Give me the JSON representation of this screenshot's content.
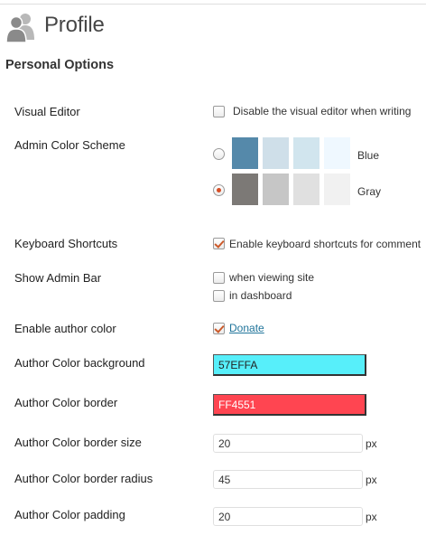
{
  "page": {
    "title": "Profile",
    "icon": "users-icon"
  },
  "section": {
    "title": "Personal Options"
  },
  "visual_editor": {
    "label": "Visual Editor",
    "checkbox_label": "Disable the visual editor when writing",
    "checked": false
  },
  "color_scheme": {
    "label": "Admin Color Scheme",
    "options": [
      {
        "name": "Blue",
        "selected": false,
        "colors": [
          "#5589aa",
          "#cfdfe9",
          "#d1e5ee",
          "#eff8ff"
        ]
      },
      {
        "name": "Gray",
        "selected": true,
        "colors": [
          "#7c7976",
          "#c6c6c6",
          "#e0e0e0",
          "#f1f1f1"
        ]
      }
    ]
  },
  "keyboard_shortcuts": {
    "label": "Keyboard Shortcuts",
    "checkbox_label": "Enable keyboard shortcuts for comment",
    "checked": true
  },
  "admin_bar": {
    "label": "Show Admin Bar",
    "options": [
      {
        "label": "when viewing site",
        "checked": false
      },
      {
        "label": "in dashboard",
        "checked": false
      }
    ]
  },
  "author_color": {
    "label": "Enable author color",
    "checked": true,
    "link_text": "Donate"
  },
  "author_bg": {
    "label": "Author Color background",
    "value": "57EFFA",
    "color": "#57effa",
    "text_color": "#222222"
  },
  "author_border": {
    "label": "Author Color border",
    "value": "FF4551",
    "color": "#ff4551",
    "text_color": "#ffffff"
  },
  "border_size": {
    "label": "Author Color border size",
    "value": "20",
    "unit": "px"
  },
  "border_radius": {
    "label": "Author Color border radius",
    "value": "45",
    "unit": "px"
  },
  "padding": {
    "label": "Author Color padding",
    "value": "20",
    "unit": "px"
  }
}
